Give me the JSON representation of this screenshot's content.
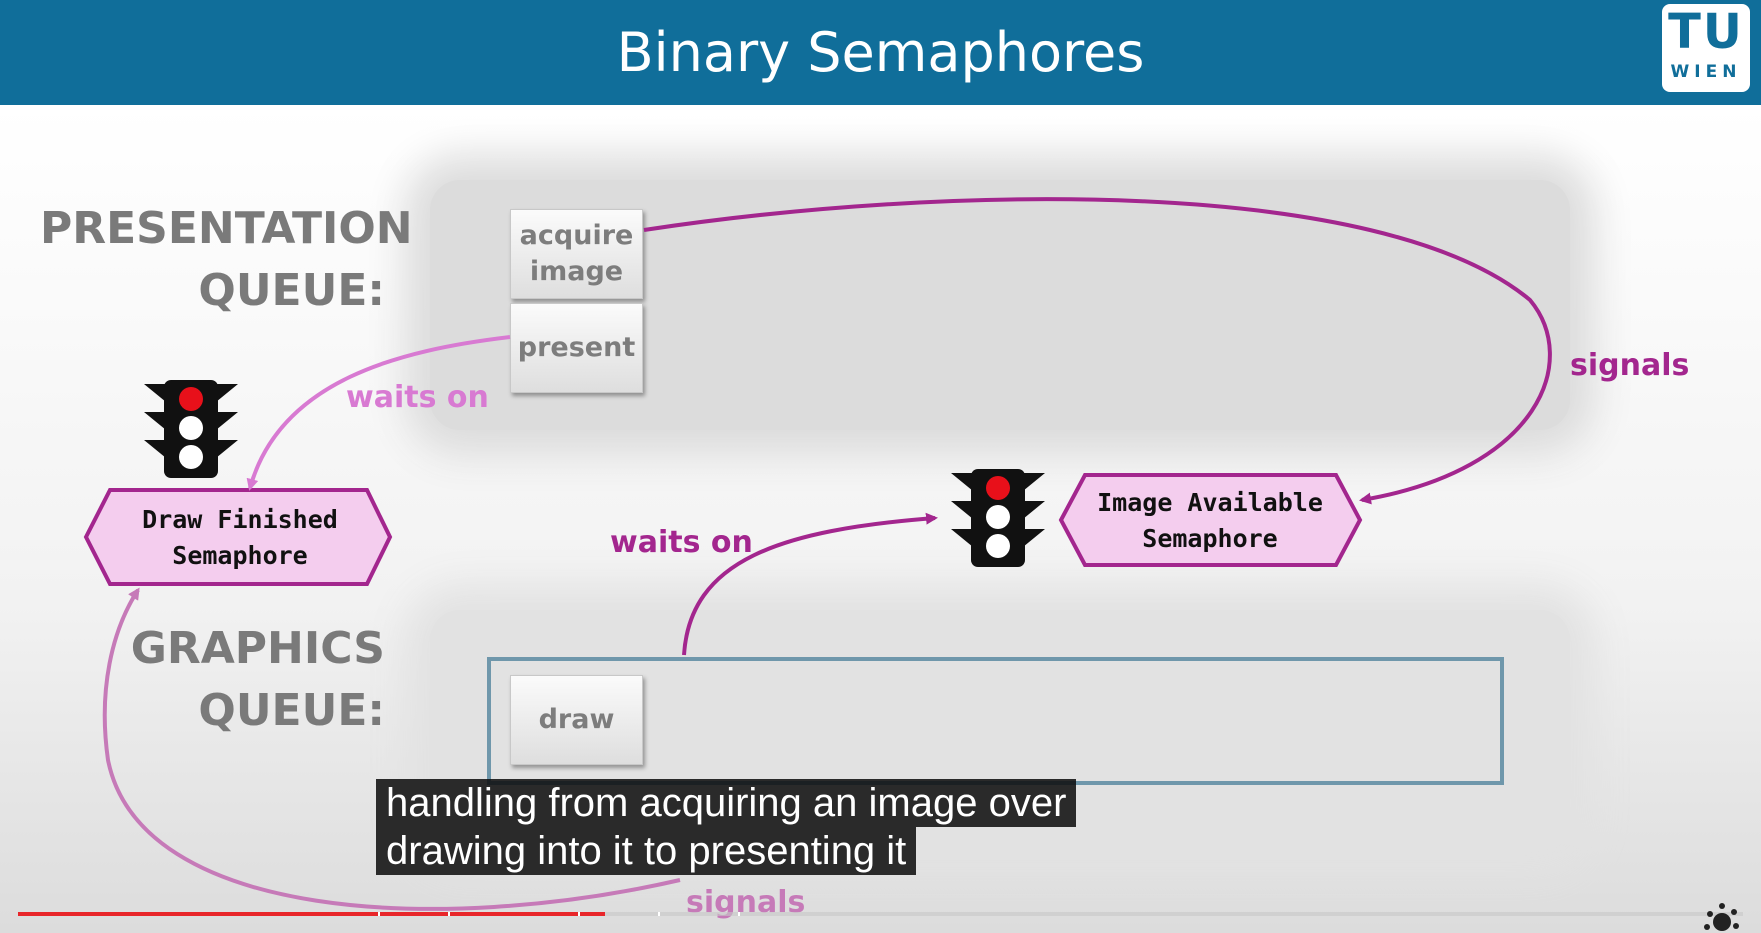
{
  "header": {
    "title": "Binary Semaphores",
    "logo_top": "TU",
    "logo_bottom": "WIEN",
    "color": "#106e9a"
  },
  "queues": {
    "presentation_label_line1": "PRESENTATION",
    "presentation_label_line2": "QUEUE:",
    "graphics_label_line1": "GRAPHICS",
    "graphics_label_line2": "QUEUE:"
  },
  "commands": {
    "acquire_line1": "acquire",
    "acquire_line2": "image",
    "present": "present",
    "draw": "draw"
  },
  "semaphores": {
    "draw_finished_line1": "Draw Finished",
    "draw_finished_line2": "Semaphore",
    "image_available_line1": "Image Available",
    "image_available_line2": "Semaphore",
    "fill_color": "#f4cdee",
    "border_color": "#a3268e"
  },
  "arrows": {
    "signals_top": "signals",
    "waits_on_top": "waits on",
    "waits_on_middle": "waits on",
    "signals_bottom": "signals"
  },
  "icons": {
    "traffic_light": "traffic-light-icon",
    "corner": "splash-icon"
  },
  "captions": {
    "line1": "handling from acquiring an image over",
    "line2": "drawing into it to presenting it"
  },
  "video_progress": {
    "played_fraction": 0.34,
    "accent": "#e8262a"
  }
}
